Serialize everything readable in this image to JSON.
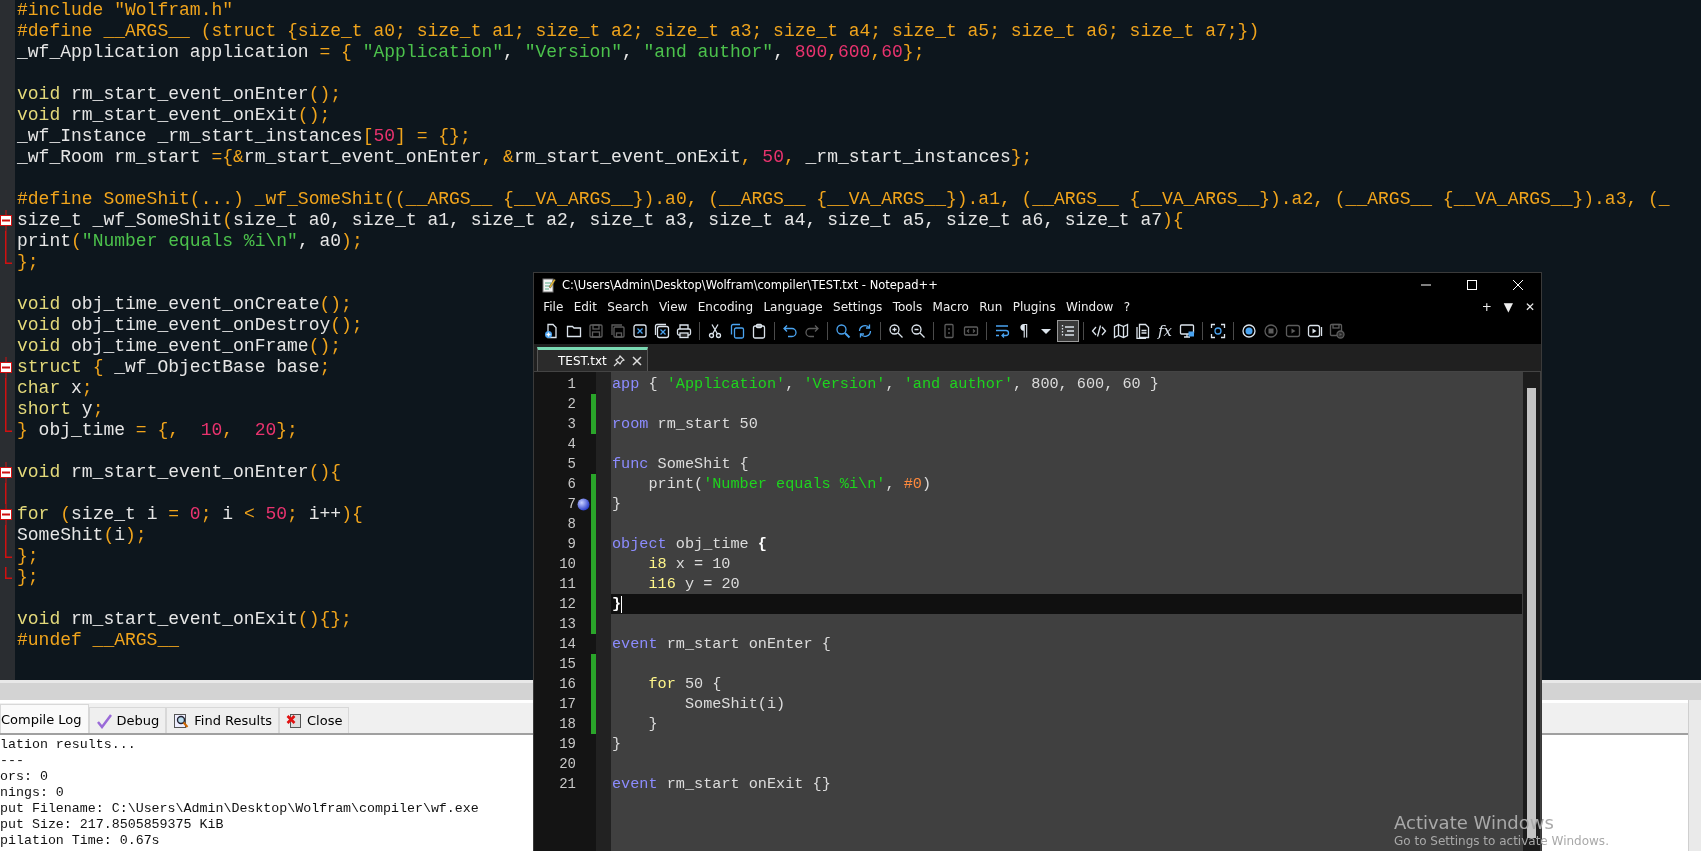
{
  "editor": {
    "lines": [
      {
        "segments": [
          {
            "text": "#include \"Wolfram.h\"",
            "kind": "p"
          }
        ]
      },
      {
        "segments": [
          {
            "text": "#define __ARGS__ (struct {size_t a0; size_t a1; size_t a2; size_t a3; size_t a4; size_t a5; size_t a6; size_t a7;})",
            "kind": "p"
          }
        ]
      },
      {
        "segments": [
          {
            "text": "_wf_Application application ",
            "kind": "i"
          },
          {
            "text": "= { ",
            "kind": "p"
          },
          {
            "text": "\"Application\"",
            "kind": "s"
          },
          {
            "text": ", ",
            "kind": "i"
          },
          {
            "text": "\"Version\"",
            "kind": "s"
          },
          {
            "text": ", ",
            "kind": "i"
          },
          {
            "text": "\"and author\"",
            "kind": "s"
          },
          {
            "text": ", ",
            "kind": "i"
          },
          {
            "text": "800",
            "kind": "n"
          },
          {
            "text": ",",
            "kind": "p"
          },
          {
            "text": "600",
            "kind": "n"
          },
          {
            "text": ",",
            "kind": "p"
          },
          {
            "text": "60",
            "kind": "n"
          },
          {
            "text": "};",
            "kind": "p"
          }
        ]
      },
      {
        "blank_before": true,
        "segments": [
          {
            "text": "void ",
            "kind": "k"
          },
          {
            "text": "rm_start_event_onEnter",
            "kind": "i"
          },
          {
            "text": "();",
            "kind": "p"
          }
        ]
      },
      {
        "segments": [
          {
            "text": "void ",
            "kind": "k"
          },
          {
            "text": "rm_start_event_onExit",
            "kind": "i"
          },
          {
            "text": "();",
            "kind": "p"
          }
        ]
      },
      {
        "segments": [
          {
            "text": "_wf_Instance _rm_start_instances",
            "kind": "i"
          },
          {
            "text": "[",
            "kind": "p"
          },
          {
            "text": "50",
            "kind": "n"
          },
          {
            "text": "] = {};",
            "kind": "p"
          }
        ]
      },
      {
        "segments": [
          {
            "text": "_wf_Room rm_start ",
            "kind": "i"
          },
          {
            "text": "={&",
            "kind": "p"
          },
          {
            "text": "rm_start_event_onEnter",
            "kind": "i"
          },
          {
            "text": ", &",
            "kind": "p"
          },
          {
            "text": "rm_start_event_onExit",
            "kind": "i"
          },
          {
            "text": ", ",
            "kind": "p"
          },
          {
            "text": "50",
            "kind": "n"
          },
          {
            "text": ", ",
            "kind": "p"
          },
          {
            "text": "_rm_start_instances",
            "kind": "i"
          },
          {
            "text": "};",
            "kind": "p"
          }
        ]
      },
      {
        "blank_before": true,
        "segments": [
          {
            "text": "#define SomeShit(...) _wf_SomeShit((__ARGS__ {__VA_ARGS__}).a0, (__ARGS__ {__VA_ARGS__}).a1, (__ARGS__ {__VA_ARGS__}).a2, (__ARGS__ {__VA_ARGS__}).a3, (_",
            "kind": "p"
          }
        ]
      },
      {
        "fold_marker": true,
        "segments": [
          {
            "text": "size_t _wf_SomeShit",
            "kind": "i"
          },
          {
            "text": "(",
            "kind": "p"
          },
          {
            "text": "size_t a0, size_t a1, size_t a2, size_t a3, size_t a4, size_t a5, size_t a6, size_t a7",
            "kind": "i"
          },
          {
            "text": "){",
            "kind": "p"
          }
        ]
      },
      {
        "fold_line": true,
        "segments": [
          {
            "text": "print",
            "kind": "i"
          },
          {
            "text": "(",
            "kind": "p"
          },
          {
            "text": "\"Number equals %i\\n\"",
            "kind": "s"
          },
          {
            "text": ", a0",
            "kind": "i"
          },
          {
            "text": ");",
            "kind": "p"
          }
        ]
      },
      {
        "fold_end": true,
        "segments": [
          {
            "text": "};",
            "kind": "p"
          }
        ]
      },
      {
        "blank_before": true,
        "segments": [
          {
            "text": "void ",
            "kind": "k"
          },
          {
            "text": "obj_time_event_onCreate",
            "kind": "i"
          },
          {
            "text": "();",
            "kind": "p"
          }
        ]
      },
      {
        "segments": [
          {
            "text": "void ",
            "kind": "k"
          },
          {
            "text": "obj_time_event_onDestroy",
            "kind": "i"
          },
          {
            "text": "();",
            "kind": "p"
          }
        ]
      },
      {
        "segments": [
          {
            "text": "void ",
            "kind": "k"
          },
          {
            "text": "obj_time_event_onFrame",
            "kind": "i"
          },
          {
            "text": "();",
            "kind": "p"
          }
        ]
      },
      {
        "fold_marker": true,
        "segments": [
          {
            "text": "struct ",
            "kind": "k"
          },
          {
            "text": "{ ",
            "kind": "p"
          },
          {
            "text": "_wf_ObjectBase base",
            "kind": "i"
          },
          {
            "text": ";",
            "kind": "p"
          }
        ]
      },
      {
        "fold_line": true,
        "segments": [
          {
            "text": "char ",
            "kind": "k"
          },
          {
            "text": "x",
            "kind": "i"
          },
          {
            "text": ";",
            "kind": "p"
          }
        ]
      },
      {
        "fold_line": true,
        "segments": [
          {
            "text": "short ",
            "kind": "k"
          },
          {
            "text": "y",
            "kind": "i"
          },
          {
            "text": ";",
            "kind": "p"
          }
        ]
      },
      {
        "fold_end": true,
        "segments": [
          {
            "text": "} ",
            "kind": "p"
          },
          {
            "text": "obj_time ",
            "kind": "i"
          },
          {
            "text": "= {,  ",
            "kind": "p"
          },
          {
            "text": "10",
            "kind": "n"
          },
          {
            "text": ",  ",
            "kind": "p"
          },
          {
            "text": "20",
            "kind": "n"
          },
          {
            "text": "};",
            "kind": "p"
          }
        ]
      },
      {
        "blank_before": true,
        "fold_marker": true,
        "segments": [
          {
            "text": "void ",
            "kind": "k"
          },
          {
            "text": "rm_start_event_onEnter",
            "kind": "i"
          },
          {
            "text": "(){",
            "kind": "p"
          }
        ]
      },
      {
        "fold_line": true
      },
      {
        "fold_marker": true,
        "segments": [
          {
            "text": "for ",
            "kind": "k"
          },
          {
            "text": "(",
            "kind": "p"
          },
          {
            "text": "size_t i ",
            "kind": "i"
          },
          {
            "text": "= ",
            "kind": "p"
          },
          {
            "text": "0",
            "kind": "n"
          },
          {
            "text": "; ",
            "kind": "p"
          },
          {
            "text": "i ",
            "kind": "i"
          },
          {
            "text": "< ",
            "kind": "p"
          },
          {
            "text": "50",
            "kind": "n"
          },
          {
            "text": "; ",
            "kind": "p"
          },
          {
            "text": "i++",
            "kind": "i"
          },
          {
            "text": "){",
            "kind": "p"
          }
        ]
      },
      {
        "fold_line": true,
        "segments": [
          {
            "text": "SomeShit",
            "kind": "i"
          },
          {
            "text": "(",
            "kind": "p"
          },
          {
            "text": "i",
            "kind": "i"
          },
          {
            "text": ");",
            "kind": "p"
          }
        ]
      },
      {
        "fold_end": true,
        "segments": [
          {
            "text": "};",
            "kind": "p"
          }
        ]
      },
      {
        "fold_end": true,
        "segments": [
          {
            "text": "};",
            "kind": "p"
          }
        ]
      },
      {
        "blank_before": true,
        "segments": [
          {
            "text": "void ",
            "kind": "k"
          },
          {
            "text": "rm_start_event_onExit",
            "kind": "i"
          },
          {
            "text": "(){};",
            "kind": "p"
          }
        ]
      },
      {
        "segments": [
          {
            "text": "#undef __ARGS__",
            "kind": "p"
          }
        ]
      }
    ]
  },
  "output_panel": {
    "tabs": [
      {
        "label": "Compile Log",
        "selected": true
      },
      {
        "label": "Debug",
        "selected": false
      },
      {
        "label": "Find Results",
        "selected": false
      },
      {
        "label": "Close",
        "selected": false
      }
    ],
    "log": [
      "lation results...",
      "---",
      "ors: 0",
      "nings: 0",
      "put Filename: C:\\Users\\Admin\\Desktop\\Wolfram\\compiler\\wf.exe",
      "put Size: 217.8505859375 KiB",
      "pilation Time: 0.67s"
    ]
  },
  "notepad": {
    "title": "C:\\Users\\Admin\\Desktop\\Wolfram\\compiler\\TEST.txt - Notepad++",
    "menu": [
      "File",
      "Edit",
      "Search",
      "View",
      "Encoding",
      "Language",
      "Settings",
      "Tools",
      "Macro",
      "Run",
      "Plugins",
      "Window",
      "?"
    ],
    "menu_right": [
      "+",
      "▼",
      "✕"
    ],
    "toolbar": [
      {
        "disabled": false,
        "pressed": false
      },
      {
        "disabled": false,
        "pressed": false
      },
      {
        "disabled": true,
        "pressed": false
      },
      {
        "disabled": true,
        "pressed": false
      },
      {
        "disabled": false,
        "pressed": false
      },
      {
        "disabled": false,
        "pressed": false
      },
      {
        "disabled": false,
        "pressed": false
      },
      {
        "disabled": false,
        "pressed": false
      },
      {
        "disabled": false,
        "pressed": false
      },
      {
        "disabled": false,
        "pressed": false
      },
      {
        "disabled": false,
        "pressed": false
      },
      {
        "disabled": true,
        "pressed": false
      },
      {
        "disabled": false,
        "pressed": false
      },
      {
        "disabled": false,
        "pressed": false
      },
      {
        "disabled": false,
        "pressed": false
      },
      {
        "disabled": false,
        "pressed": false
      },
      {
        "disabled": true,
        "pressed": false
      },
      {
        "disabled": true,
        "pressed": false
      },
      {
        "disabled": false,
        "pressed": false
      },
      {
        "disabled": false,
        "pressed": false,
        "label": "¶"
      },
      {
        "disabled": false,
        "pressed": false
      },
      {
        "disabled": false,
        "pressed": true
      },
      {
        "disabled": false,
        "pressed": false
      },
      {
        "disabled": false,
        "pressed": false
      },
      {
        "disabled": false,
        "pressed": false
      },
      {
        "disabled": false,
        "pressed": false,
        "label": "fx"
      },
      {
        "disabled": false,
        "pressed": false
      },
      {
        "disabled": false,
        "pressed": false
      },
      {
        "disabled": false,
        "pressed": false
      },
      {
        "disabled": true,
        "pressed": false
      },
      {
        "disabled": true,
        "pressed": false
      },
      {
        "disabled": false,
        "pressed": false
      },
      {
        "disabled": true,
        "pressed": false
      }
    ],
    "tabs": [
      {
        "label": "TEST.txt",
        "selected": true
      }
    ],
    "lines": [
      {
        "number": "1",
        "changed": false,
        "bookmark": false,
        "current": false,
        "segments": [
          {
            "text": "app",
            "kind": "kw"
          },
          {
            "text": " { ",
            "kind": "o"
          },
          {
            "text": "'Application'",
            "kind": "s"
          },
          {
            "text": ", ",
            "kind": "o"
          },
          {
            "text": "'Version'",
            "kind": "s"
          },
          {
            "text": ", ",
            "kind": "o"
          },
          {
            "text": "'and author'",
            "kind": "s"
          },
          {
            "text": ", 800, 600, 60 }",
            "kind": "o"
          }
        ]
      },
      {
        "number": "2",
        "changed": true,
        "bookmark": false,
        "current": false
      },
      {
        "number": "3",
        "changed": true,
        "bookmark": false,
        "current": false,
        "segments": [
          {
            "text": "room",
            "kind": "kw"
          },
          {
            "text": " rm_start 50",
            "kind": "o"
          }
        ]
      },
      {
        "number": "4",
        "changed": false,
        "bookmark": false,
        "current": false
      },
      {
        "number": "5",
        "changed": false,
        "bookmark": false,
        "current": false,
        "segments": [
          {
            "text": "func",
            "kind": "kw"
          },
          {
            "text": " SomeShit {",
            "kind": "o"
          }
        ]
      },
      {
        "number": "6",
        "changed": true,
        "bookmark": false,
        "current": false,
        "segments": [
          {
            "text": "    print(",
            "kind": "o"
          },
          {
            "text": "'Number equals %i\\n'",
            "kind": "s"
          },
          {
            "text": ", ",
            "kind": "o"
          },
          {
            "text": "#0",
            "kind": "n"
          },
          {
            "text": ")",
            "kind": "o"
          }
        ]
      },
      {
        "number": "7",
        "changed": true,
        "bookmark": true,
        "current": false,
        "segments": [
          {
            "text": "}",
            "kind": "o"
          }
        ]
      },
      {
        "number": "8",
        "changed": true,
        "bookmark": false,
        "current": false
      },
      {
        "number": "9",
        "changed": true,
        "bookmark": false,
        "current": false,
        "segments": [
          {
            "text": "object",
            "kind": "kw"
          },
          {
            "text": " obj_time ",
            "kind": "o"
          },
          {
            "text": "{",
            "kind": "b"
          }
        ]
      },
      {
        "number": "10",
        "changed": true,
        "bookmark": false,
        "current": false,
        "segments": [
          {
            "text": "    i8",
            "kind": "t"
          },
          {
            "text": " x = 10",
            "kind": "o"
          }
        ]
      },
      {
        "number": "11",
        "changed": true,
        "bookmark": false,
        "current": false,
        "segments": [
          {
            "text": "    i16",
            "kind": "t"
          },
          {
            "text": " y = 20",
            "kind": "o"
          }
        ]
      },
      {
        "number": "12",
        "changed": true,
        "bookmark": false,
        "current": true,
        "segments": [
          {
            "text": "}",
            "kind": "b"
          }
        ]
      },
      {
        "number": "13",
        "changed": true,
        "bookmark": false,
        "current": false
      },
      {
        "number": "14",
        "changed": false,
        "bookmark": false,
        "current": false,
        "segments": [
          {
            "text": "event",
            "kind": "kw"
          },
          {
            "text": " rm_start onEnter {",
            "kind": "o"
          }
        ]
      },
      {
        "number": "15",
        "changed": true,
        "bookmark": false,
        "current": false
      },
      {
        "number": "16",
        "changed": true,
        "bookmark": false,
        "current": false,
        "segments": [
          {
            "text": "    for",
            "kind": "t"
          },
          {
            "text": " 50 {",
            "kind": "o"
          }
        ]
      },
      {
        "number": "17",
        "changed": true,
        "bookmark": false,
        "current": false,
        "segments": [
          {
            "text": "        SomeShit(i)",
            "kind": "o"
          }
        ]
      },
      {
        "number": "18",
        "changed": true,
        "bookmark": false,
        "current": false,
        "segments": [
          {
            "text": "    }",
            "kind": "o"
          }
        ]
      },
      {
        "number": "19",
        "changed": false,
        "bookmark": false,
        "current": false,
        "segments": [
          {
            "text": "}",
            "kind": "o"
          }
        ]
      },
      {
        "number": "20",
        "changed": false,
        "bookmark": false,
        "current": false
      },
      {
        "number": "21",
        "changed": false,
        "bookmark": false,
        "current": false,
        "segments": [
          {
            "text": "event",
            "kind": "kw"
          },
          {
            "text": " rm_start onExit {}",
            "kind": "o"
          }
        ]
      }
    ]
  },
  "activation_notice": {
    "title": "Activate Windows",
    "subtitle": "Go to Settings to activate Windows."
  }
}
